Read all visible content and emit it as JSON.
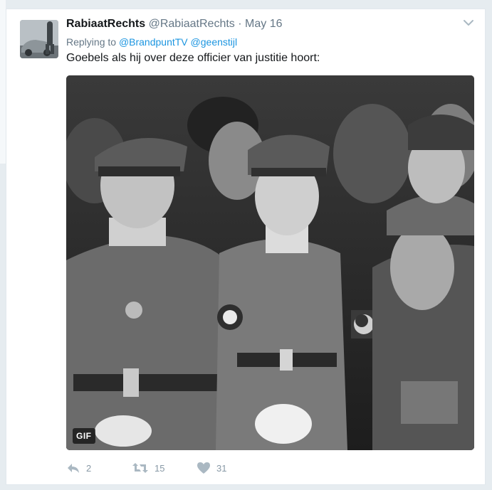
{
  "tweet": {
    "display_name": "RabiaatRechts",
    "handle": "@RabiaatRechts",
    "separator": "·",
    "date": "May 16",
    "replying_prefix": "Replying to",
    "reply_mentions": [
      "@BrandpuntTV",
      "@geenstijl"
    ],
    "text": "Goebels als hij over deze officier van justitie hoort:",
    "media": {
      "type_badge": "GIF",
      "description_icon": "animated-gif"
    },
    "actions": {
      "reply_count": "2",
      "retweet_count": "15",
      "like_count": "31"
    }
  },
  "colors": {
    "link": "#1b95e0",
    "muted": "#657786",
    "icon": "#aab8c2",
    "background": "#e6ecf0"
  },
  "icons": {
    "more": "chevron-down-icon",
    "reply": "reply-icon",
    "retweet": "retweet-icon",
    "like": "heart-icon"
  }
}
